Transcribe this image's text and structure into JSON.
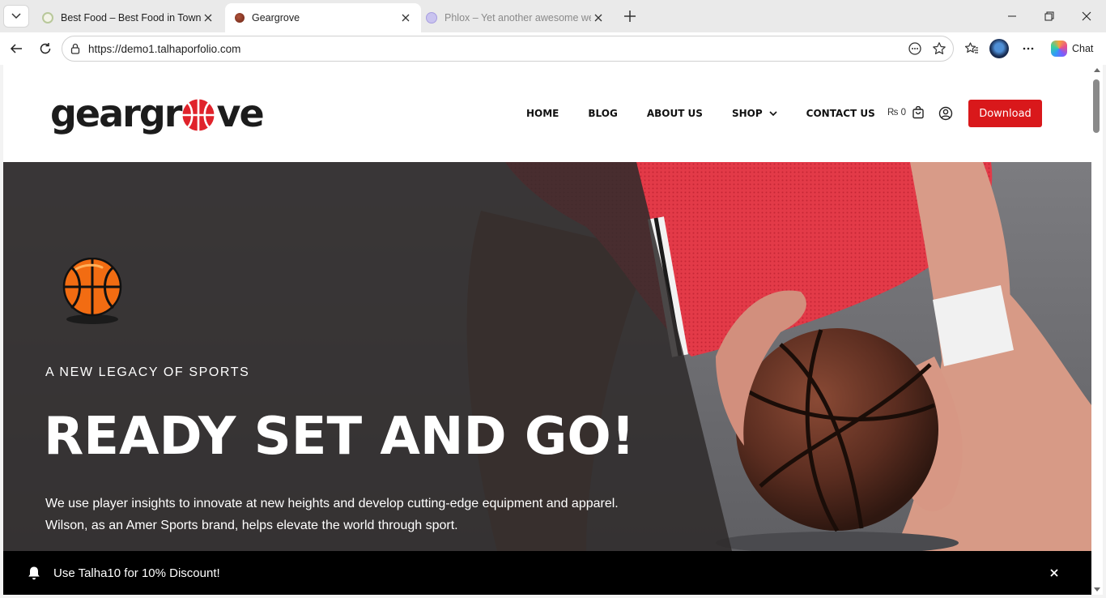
{
  "browser": {
    "tabs": [
      {
        "title": "Best Food – Best Food in Town",
        "state": "inactive"
      },
      {
        "title": "Geargrove",
        "state": "active"
      },
      {
        "title": "Phlox – Yet another awesome web",
        "state": "faded"
      }
    ],
    "url": "https://demo1.talhaporfolio.com",
    "chat_label": "Chat",
    "icons": [
      "tab-list-icon",
      "close-icon",
      "new-tab-icon",
      "minimize-icon",
      "maximize-icon",
      "window-close-icon",
      "back-icon",
      "refresh-icon",
      "lock-icon",
      "reading-icon",
      "favorite-star-icon",
      "favorites-icon",
      "profile-avatar",
      "more-icon",
      "copilot-icon"
    ]
  },
  "site": {
    "logo_left": "geargr",
    "logo_right": "ve",
    "nav": [
      {
        "label": "HOME"
      },
      {
        "label": "BLOG"
      },
      {
        "label": "ABOUT US"
      },
      {
        "label": "SHOP",
        "has_dropdown": true
      },
      {
        "label": "CONTACT US"
      }
    ],
    "cart_total": "₨ 0",
    "download_label": "Download",
    "accent_color": "#d9181b"
  },
  "hero": {
    "eyebrow": "A NEW LEGACY OF SPORTS",
    "title": "READY SET AND GO!",
    "description": "We use player insights to innovate at new heights and develop cutting-edge equipment and apparel. Wilson, as an Amer Sports brand, helps elevate the world through sport."
  },
  "notice": {
    "text": "Use Talha10 for 10% Discount!"
  }
}
